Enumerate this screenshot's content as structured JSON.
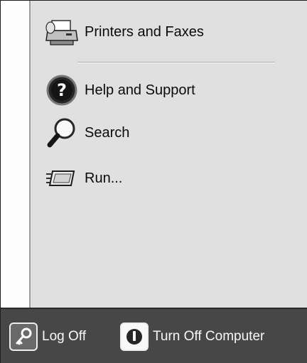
{
  "menu": {
    "items": [
      {
        "label": "Printers and Faxes",
        "icon": "printer-icon"
      },
      {
        "label": "Help and Support",
        "icon": "help-icon"
      },
      {
        "label": "Search",
        "icon": "search-icon"
      },
      {
        "label": "Run...",
        "icon": "run-icon"
      }
    ]
  },
  "footer": {
    "log_off": {
      "label": "Log Off",
      "icon": "key-icon"
    },
    "turn_off": {
      "label": "Turn Off Computer",
      "icon": "power-icon"
    }
  }
}
